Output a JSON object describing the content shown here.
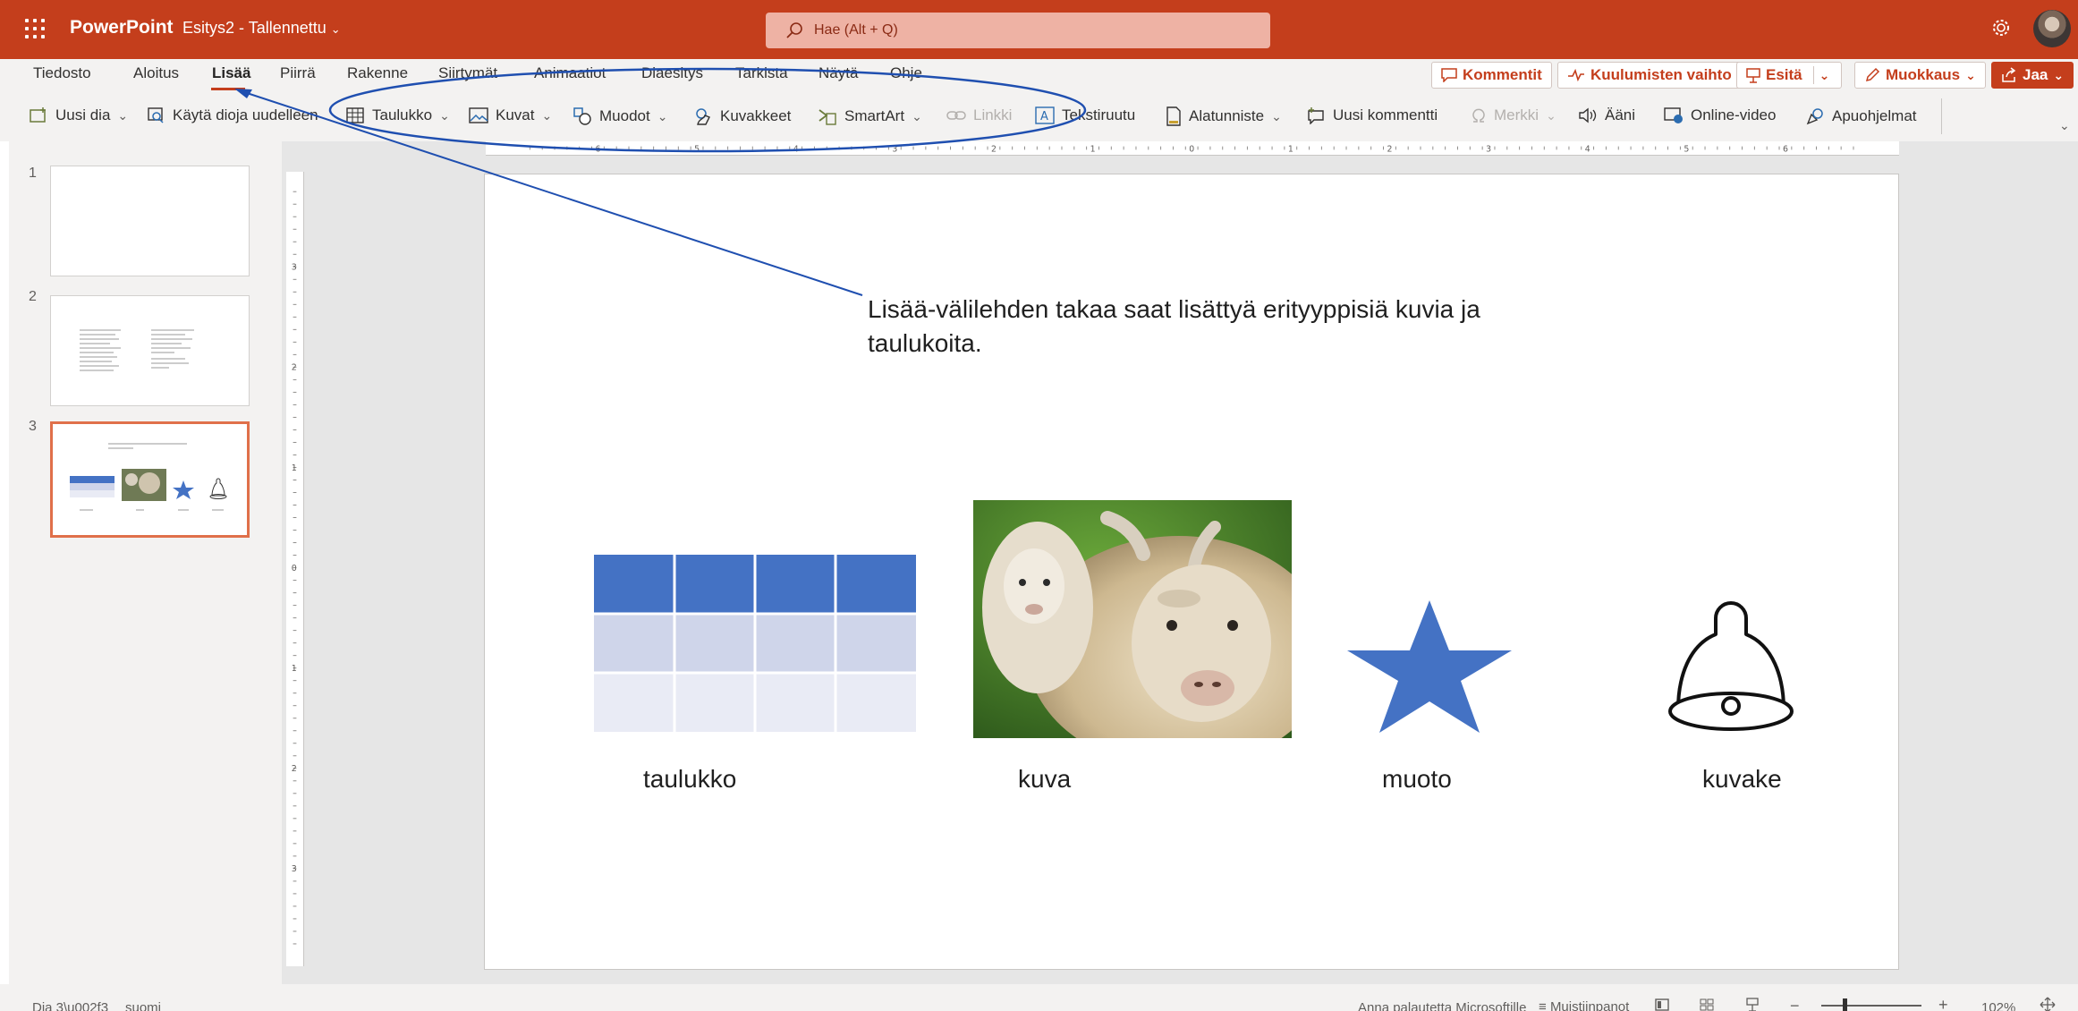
{
  "titlebar": {
    "app_name": "PowerPoint",
    "doc_title": "Esitys2 - Tallennettu",
    "search_placeholder": "Hae (Alt + Q)"
  },
  "menu": {
    "tabs": [
      "Tiedosto",
      "Aloitus",
      "Lisää",
      "Piirrä",
      "Rakenne",
      "Siirtymät",
      "Animaatiot",
      "Diaesitys",
      "Tarkista",
      "Näytä",
      "Ohje"
    ],
    "active_tab": "Lisää",
    "comments_label": "Kommentit",
    "catchup_label": "Kuulumisten vaihto",
    "present_label": "Esitä",
    "editing_label": "Muokkaus",
    "share_label": "Jaa"
  },
  "ribbon": {
    "new_slide": "Uusi dia",
    "reuse_slides": "Käytä dioja uudelleen",
    "table": "Taulukko",
    "pictures": "Kuvat",
    "shapes": "Muodot",
    "icons": "Kuvakkeet",
    "smartart": "SmartArt",
    "link": "Linkki",
    "textbox": "Tekstiruutu",
    "footer": "Alatunniste",
    "new_comment": "Uusi kommentti",
    "symbol": "Merkki",
    "audio": "Ääni",
    "online_video": "Online-video",
    "addins": "Apuohjelmat"
  },
  "thumbnails": {
    "numbers": [
      "1",
      "2",
      "3"
    ],
    "selected": "3"
  },
  "slide": {
    "annotation": "Lisää-välilehden takaa saat lisättyä erityyppisiä kuvia ja taulukoita.",
    "captions": {
      "table": "taulukko",
      "picture": "kuva",
      "shape": "muoto",
      "icon": "kuvake"
    },
    "accent_color": "#4472c4",
    "annotation_color": "#1f4fb0"
  },
  "statusbar": {
    "slide_info": "Dia 3\\u002f3",
    "language": "suomi",
    "feedback": "Anna palautetta Microsoftille",
    "notes": "Muistiinpanot",
    "zoom": "102%"
  }
}
